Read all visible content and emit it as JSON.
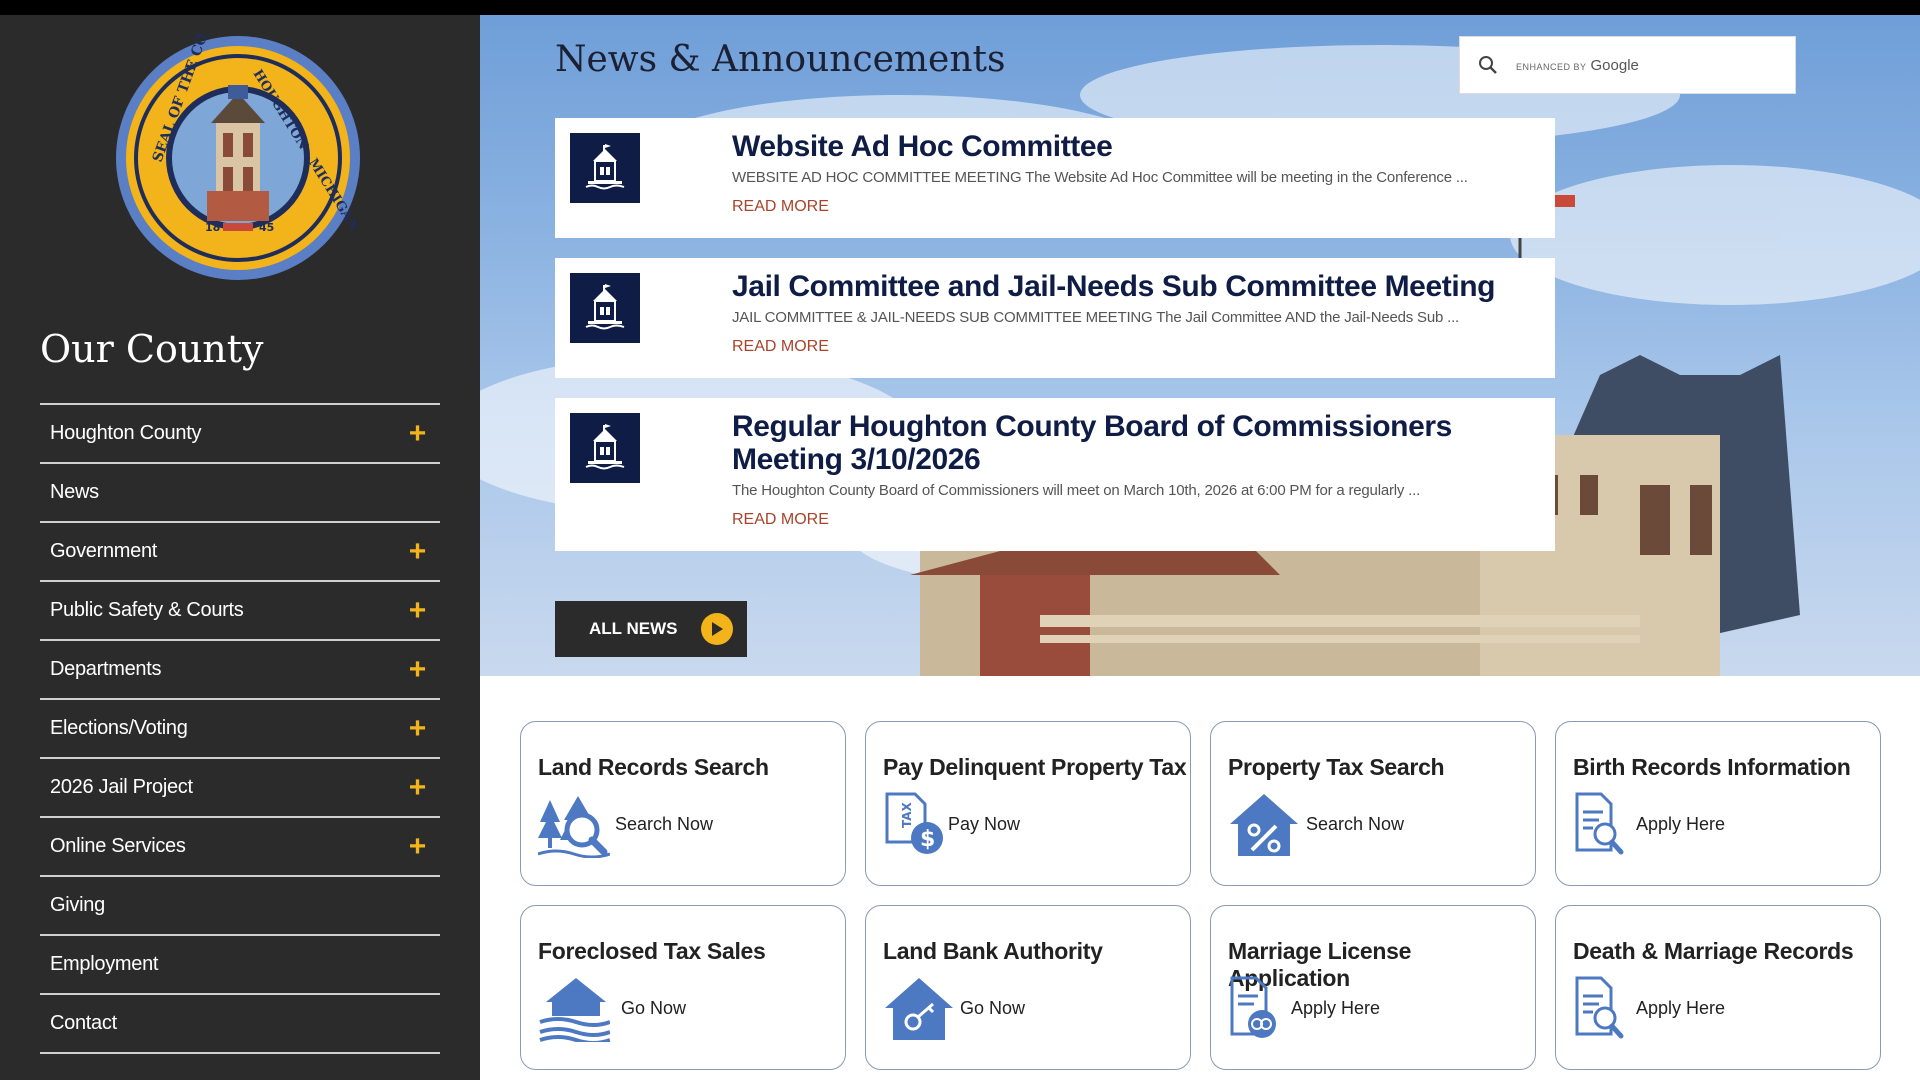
{
  "sidebar": {
    "title": "Our County",
    "seal": {
      "text_top": "SEAL OF THE COUNTY OF",
      "text_right": "HOUGHTON · MICHIGAN",
      "year_left": "18",
      "year_right": "45"
    },
    "items": [
      {
        "label": "Houghton County",
        "expandable": true
      },
      {
        "label": "News",
        "expandable": false
      },
      {
        "label": "Government",
        "expandable": true
      },
      {
        "label": "Public Safety & Courts",
        "expandable": true
      },
      {
        "label": "Departments",
        "expandable": true
      },
      {
        "label": "Elections/Voting",
        "expandable": true
      },
      {
        "label": "2026 Jail Project",
        "expandable": true
      },
      {
        "label": "Online Services",
        "expandable": true
      },
      {
        "label": "Giving",
        "expandable": false
      },
      {
        "label": "Employment",
        "expandable": false
      },
      {
        "label": "Contact",
        "expandable": false
      }
    ]
  },
  "news": {
    "heading": "News & Announcements",
    "search": {
      "brand_small": "ENHANCED BY",
      "brand": "Google"
    },
    "items": [
      {
        "title": "Website Ad Hoc Committee",
        "excerpt": "WEBSITE AD HOC COMMITTEE MEETING The Website Ad Hoc Committee will be meeting in the Conference ...",
        "more": "READ MORE"
      },
      {
        "title": "Jail Committee and Jail-Needs Sub Committee Meeting",
        "excerpt": "JAIL COMMITTEE & JAIL-NEEDS SUB COMMITTEE MEETING The Jail Committee AND the Jail-Needs Sub ...",
        "more": "READ MORE"
      },
      {
        "title": "Regular Houghton County Board of Commissioners Meeting 3/10/2026",
        "excerpt": "The Houghton County Board of Commissioners will meet on March 10th, 2026 at 6:00 PM for a regularly ...",
        "more": "READ MORE"
      }
    ],
    "all_news": "ALL NEWS"
  },
  "tiles": [
    {
      "title": "Land Records Search",
      "action": "Search Now",
      "icon": "land-records-icon"
    },
    {
      "title": "Pay Delinquent Property Tax",
      "action": "Pay Now",
      "icon": "tax-payment-icon"
    },
    {
      "title": "Property Tax Search",
      "action": "Search Now",
      "icon": "house-percent-icon"
    },
    {
      "title": "Birth Records Information",
      "action": "Apply Here",
      "icon": "document-search-icon"
    },
    {
      "title": "Foreclosed Tax Sales",
      "action": "Go Now",
      "icon": "foreclosed-house-icon"
    },
    {
      "title": "Land Bank Authority",
      "action": "Go Now",
      "icon": "house-key-icon"
    },
    {
      "title": "Marriage License Application",
      "action": "Apply Here",
      "icon": "document-rings-icon"
    },
    {
      "title": "Death & Marriage Records",
      "action": "Apply Here",
      "icon": "document-search-icon"
    }
  ],
  "colors": {
    "sidebar": "#2b2b2b",
    "accent": "#f2b31b",
    "navy": "#0f1d46",
    "link": "#a8442a",
    "icon_blue": "#4d78c2"
  }
}
